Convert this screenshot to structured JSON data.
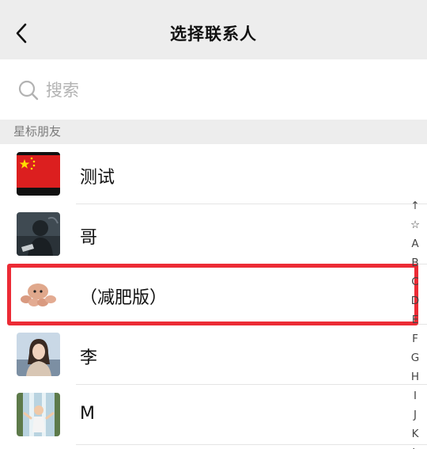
{
  "header": {
    "title": "选择联系人",
    "back_icon": "chevron-left-icon"
  },
  "search": {
    "placeholder": "搜索",
    "icon": "search-icon"
  },
  "section": {
    "title": "星标朋友"
  },
  "contacts": [
    {
      "name": "测试",
      "avatar": "china-flag"
    },
    {
      "name": "哥",
      "avatar": "dark-photo"
    },
    {
      "name": "（减肥版）",
      "avatar": "octopus-plush"
    },
    {
      "name": "李",
      "avatar": "woman-portrait"
    },
    {
      "name": "M",
      "avatar": "child-waterfall"
    }
  ],
  "index_bar": [
    "↑",
    "☆",
    "A",
    "B",
    "C",
    "D",
    "E",
    "F",
    "G",
    "H",
    "I",
    "J",
    "K",
    "L"
  ],
  "colors": {
    "highlight": "#ec2b35",
    "header_bg": "#ededed",
    "section_text": "#7b7b7b"
  }
}
